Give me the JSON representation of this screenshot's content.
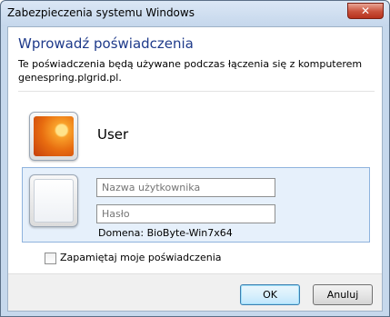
{
  "window": {
    "title": "Zabezpieczenia systemu Windows",
    "close_label": "✕"
  },
  "dialog": {
    "heading": "Wprowadź poświadczenia",
    "description": "Te poświadczenia będą używane podczas łączenia się z komputerem genespring.plgrid.pl."
  },
  "user_tile": {
    "name": "User"
  },
  "credentials": {
    "username_placeholder": "Nazwa użytkownika",
    "password_placeholder": "Hasło",
    "domain_text": "Domena: BioByte-Win7x64"
  },
  "remember": {
    "label": "Zapamiętaj moje poświadczenia"
  },
  "buttons": {
    "ok": "OK",
    "cancel": "Anuluj"
  }
}
